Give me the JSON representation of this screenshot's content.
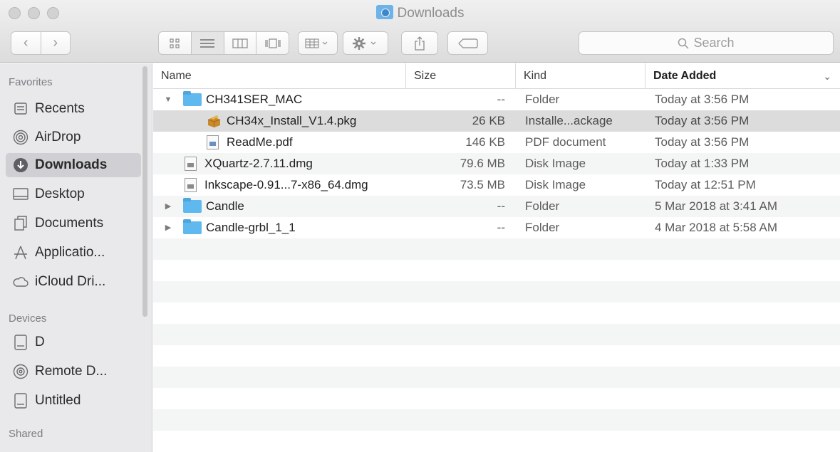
{
  "window": {
    "title": "Downloads"
  },
  "toolbar": {
    "back_glyph": "‹",
    "forward_glyph": "›",
    "search_placeholder": "Search"
  },
  "sidebar": {
    "sections": [
      {
        "heading": "Favorites"
      },
      {
        "heading": "Devices"
      },
      {
        "heading": "Shared"
      }
    ],
    "favorites": [
      {
        "label": "Recents",
        "icon": "recents-icon"
      },
      {
        "label": "AirDrop",
        "icon": "airdrop-icon"
      },
      {
        "label": "Downloads",
        "icon": "downloads-icon",
        "selected": true
      },
      {
        "label": "Desktop",
        "icon": "desktop-icon"
      },
      {
        "label": "Documents",
        "icon": "documents-icon"
      },
      {
        "label": "Applicatio...",
        "icon": "applications-icon"
      },
      {
        "label": "iCloud Dri...",
        "icon": "icloud-icon"
      }
    ],
    "devices": [
      {
        "label": "D",
        "icon": "disk-icon"
      },
      {
        "label": "Remote D...",
        "icon": "remote-disc-icon"
      },
      {
        "label": "Untitled",
        "icon": "disk-icon"
      }
    ]
  },
  "columns": {
    "name": "Name",
    "size": "Size",
    "kind": "Kind",
    "date_added": "Date Added"
  },
  "files": [
    {
      "name": "CH341SER_MAC",
      "size": "--",
      "kind": "Folder",
      "date": "Today at 3:56 PM",
      "type": "folder",
      "expanded": true,
      "depth": 0
    },
    {
      "name": "CH34x_Install_V1.4.pkg",
      "size": "26 KB",
      "kind": "Installe...ackage",
      "date": "Today at 3:56 PM",
      "type": "pkg",
      "depth": 1,
      "selected": true
    },
    {
      "name": "ReadMe.pdf",
      "size": "146 KB",
      "kind": "PDF document",
      "date": "Today at 3:56 PM",
      "type": "pdf",
      "depth": 1
    },
    {
      "name": "XQuartz-2.7.11.dmg",
      "size": "79.6 MB",
      "kind": "Disk Image",
      "date": "Today at 1:33 PM",
      "type": "dmg",
      "depth": 0
    },
    {
      "name": "Inkscape-0.91...7-x86_64.dmg",
      "size": "73.5 MB",
      "kind": "Disk Image",
      "date": "Today at 12:51 PM",
      "type": "dmg",
      "depth": 0
    },
    {
      "name": "Candle",
      "size": "--",
      "kind": "Folder",
      "date": "5 Mar 2018 at 3:41 AM",
      "type": "folder",
      "expanded": false,
      "depth": 0
    },
    {
      "name": "Candle-grbl_1_1",
      "size": "--",
      "kind": "Folder",
      "date": "4 Mar 2018 at 5:58 AM",
      "type": "folder",
      "expanded": false,
      "depth": 0
    }
  ],
  "colors": {
    "selection": "#dcdcdc",
    "folder": "#5fb8ee",
    "sidebar_bg": "#e9e9ec"
  }
}
